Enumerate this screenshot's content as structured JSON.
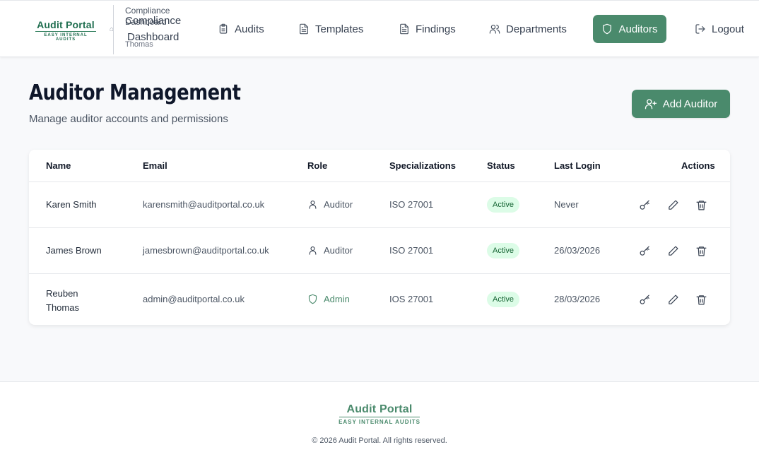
{
  "brand": {
    "title": "Audit Portal",
    "subtitle": "EASY INTERNAL AUDITS"
  },
  "breadcrumb": {
    "line1": "Compliance",
    "line2": "Dashboard",
    "line3": "Thomas",
    "overlay1": "Compliance",
    "overlay2": "Dashboard"
  },
  "nav": [
    {
      "label": "Audits",
      "icon": "clipboard-icon"
    },
    {
      "label": "Templates",
      "icon": "file-text-icon"
    },
    {
      "label": "Findings",
      "icon": "file-text-icon"
    },
    {
      "label": "Departments",
      "icon": "users-icon"
    },
    {
      "label": "Auditors",
      "icon": "shield-icon",
      "active": true
    },
    {
      "label": "Logout",
      "icon": "logout-icon"
    }
  ],
  "page": {
    "title": "Auditor Management",
    "subtitle": "Manage auditor accounts and permissions",
    "add_button": "Add Auditor"
  },
  "table": {
    "headers": {
      "name": "Name",
      "email": "Email",
      "role": "Role",
      "specializations": "Specializations",
      "status": "Status",
      "last_login": "Last Login",
      "actions": "Actions"
    },
    "rows": [
      {
        "name": "Karen Smith",
        "email": "karensmith@auditportal.co.uk",
        "role": "Auditor",
        "specialization": "ISO 27001",
        "status": "Active",
        "last_login": "Never"
      },
      {
        "name": "James Brown",
        "email": "jamesbrown@auditportal.co.uk",
        "role": "Auditor",
        "specialization": "ISO 27001",
        "status": "Active",
        "last_login": "26/03/2026"
      },
      {
        "name_line1": "Reuben",
        "name_line2": "Thomas",
        "email": "admin@auditportal.co.uk",
        "role": "Admin",
        "specialization": "IOS 27001",
        "status": "Active",
        "last_login": "28/03/2026"
      }
    ]
  },
  "footer": {
    "title": "Audit Portal",
    "subtitle": "EASY INTERNAL AUDITS",
    "copyright": "© 2026 Audit Portal. All rights reserved."
  },
  "colors": {
    "brand_green": "#4a8a6c",
    "logo_green": "#1f6e4f",
    "badge_bg": "#dcfce7",
    "badge_text": "#166534"
  }
}
